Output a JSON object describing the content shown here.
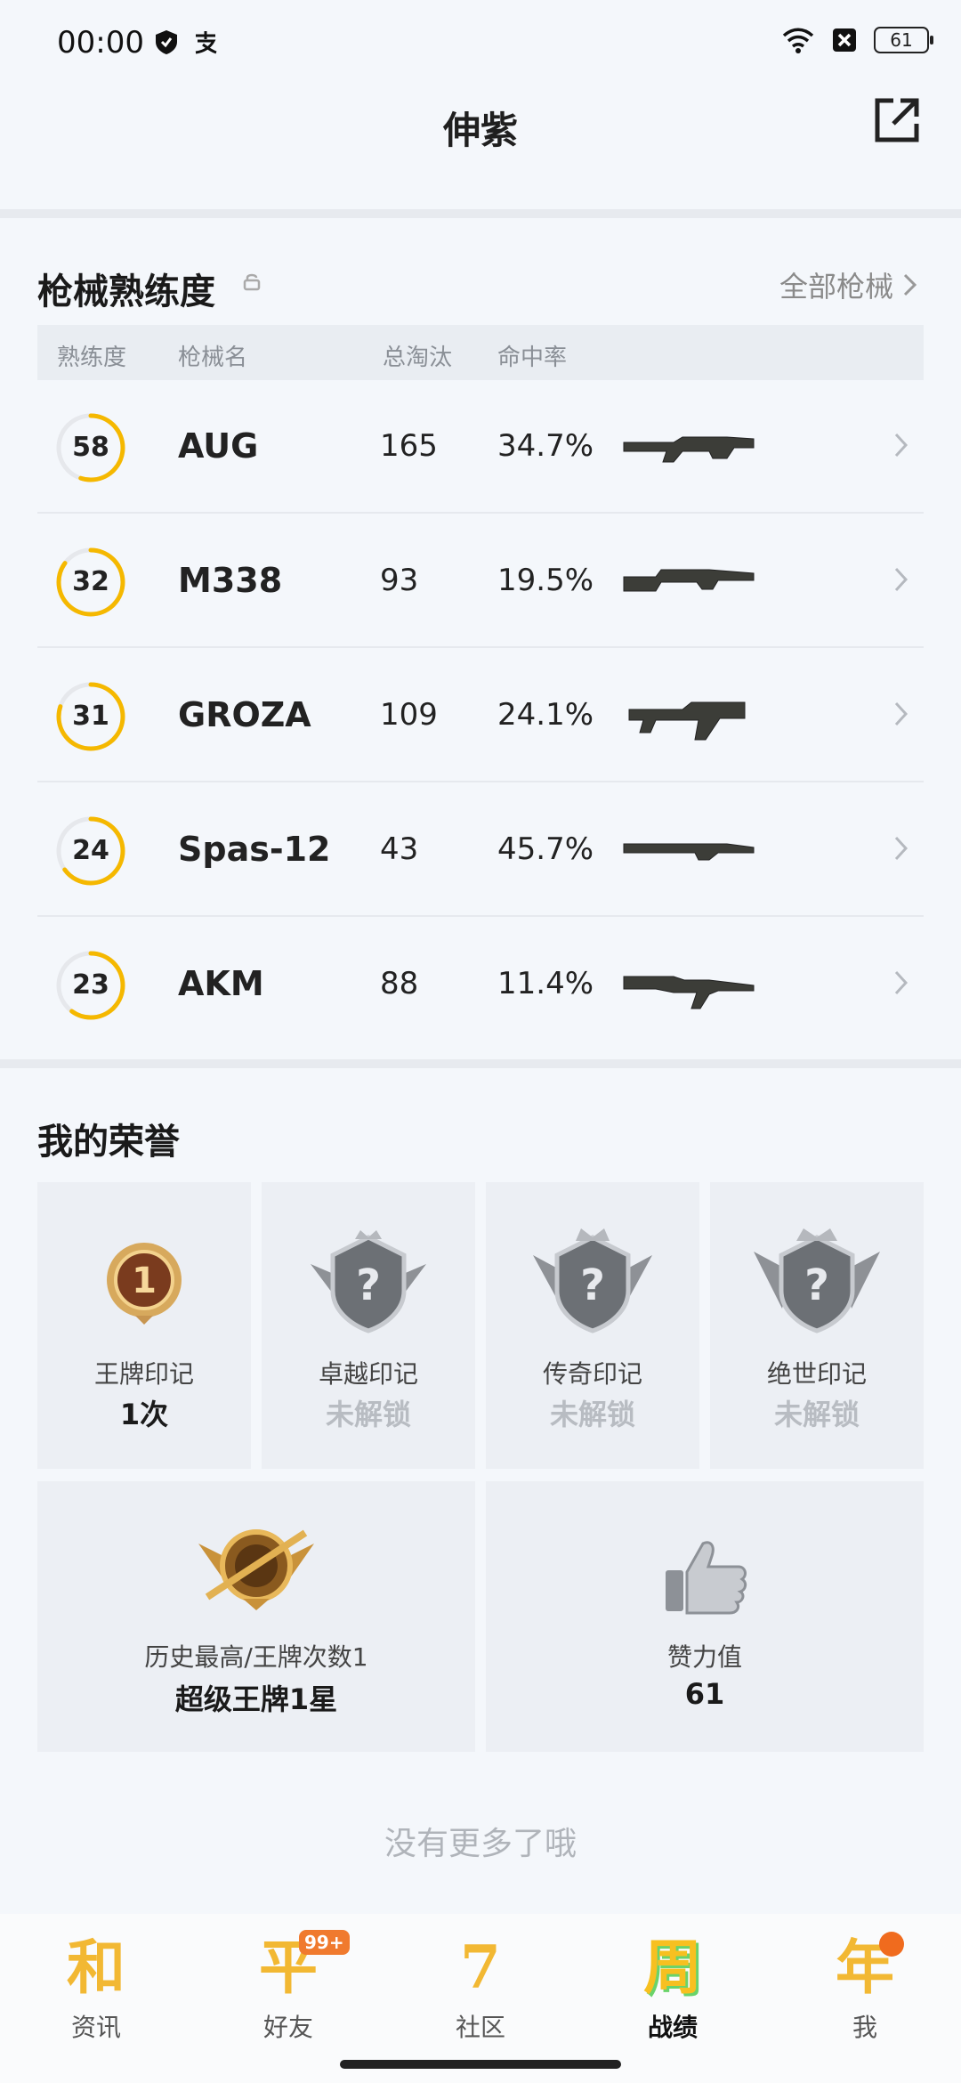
{
  "status_bar": {
    "time": "00:00",
    "battery": "61"
  },
  "header": {
    "title": "伸紫"
  },
  "weapons_section": {
    "title": "枪械熟练度",
    "all_link": "全部枪械",
    "columns": [
      "熟练度",
      "枪械名",
      "总淘汰",
      "命中率"
    ],
    "rows": [
      {
        "proficiency": "58",
        "progress": 0.55,
        "name": "AUG",
        "kills": "165",
        "accuracy": "34.7%"
      },
      {
        "proficiency": "32",
        "progress": 0.85,
        "name": "M338",
        "kills": "93",
        "accuracy": "19.5%"
      },
      {
        "proficiency": "31",
        "progress": 0.8,
        "name": "GROZA",
        "kills": "109",
        "accuracy": "24.1%"
      },
      {
        "proficiency": "24",
        "progress": 0.65,
        "name": "Spas-12",
        "kills": "43",
        "accuracy": "45.7%"
      },
      {
        "proficiency": "23",
        "progress": 0.6,
        "name": "AKM",
        "kills": "88",
        "accuracy": "11.4%"
      }
    ]
  },
  "honors_section": {
    "title": "我的荣誉",
    "marks": [
      {
        "title": "王牌印记",
        "value": "1次",
        "locked": false,
        "icon": "ace-medal-icon"
      },
      {
        "title": "卓越印记",
        "value": "未解锁",
        "locked": true,
        "icon": "locked-emblem-icon"
      },
      {
        "title": "传奇印记",
        "value": "未解锁",
        "locked": true,
        "icon": "locked-emblem-icon"
      },
      {
        "title": "绝世印记",
        "value": "未解锁",
        "locked": true,
        "icon": "locked-emblem-icon"
      }
    ],
    "history": {
      "title": "历史最高/王牌次数1",
      "value": "超级王牌1星",
      "icon": "rank-emblem-icon"
    },
    "likes": {
      "title": "赞力值",
      "value": "61",
      "icon": "thumbs-up-icon"
    }
  },
  "no_more_text": "没有更多了哦",
  "bottom_nav": {
    "items": [
      {
        "glyph": "和",
        "label": "资讯",
        "active": false
      },
      {
        "glyph": "平",
        "label": "好友",
        "active": false,
        "badge": "99+"
      },
      {
        "glyph": "7",
        "label": "社区",
        "active": false
      },
      {
        "glyph": "周",
        "label": "战绩",
        "active": true
      },
      {
        "glyph": "年",
        "label": "我",
        "active": false
      }
    ]
  },
  "colors": {
    "accent": "#f5b800",
    "ring_track": "#e6e8ec",
    "nav_glyph": "#f2b833"
  }
}
